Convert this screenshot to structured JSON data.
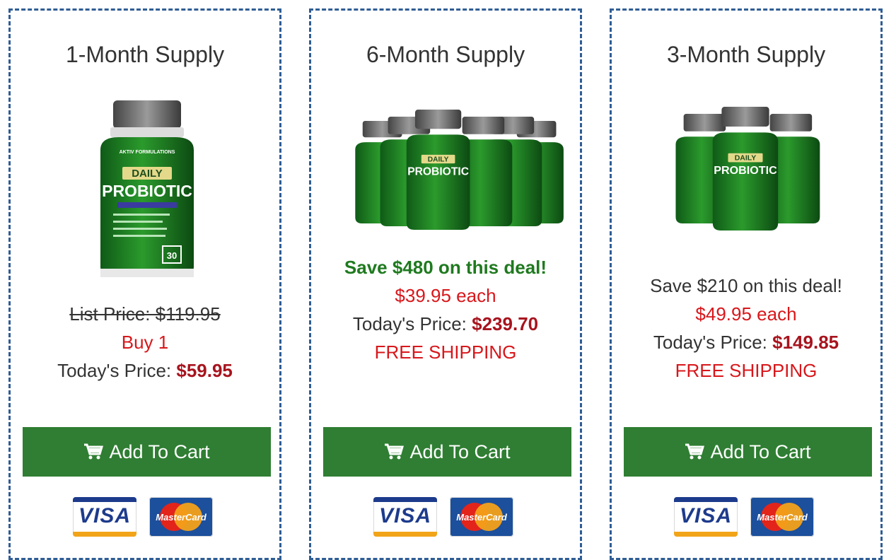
{
  "cards": [
    {
      "title": "1-Month Supply",
      "list_price": "List Price: $119.95",
      "buy_line": "Buy 1",
      "today_label": "Today's Price: ",
      "today_price": "$59.95",
      "button_label": "Add To Cart"
    },
    {
      "title": "6-Month Supply",
      "save_line": "Save $480 on this deal!",
      "each_line": "$39.95 each",
      "today_label": "Today's Price: ",
      "today_price": "$239.70",
      "shipping": "FREE SHIPPING",
      "button_label": "Add To Cart"
    },
    {
      "title": "3-Month Supply",
      "save_line": "Save $210 on this deal!",
      "each_line": "$49.95 each",
      "today_label": "Today's Price: ",
      "today_price": "$149.85",
      "shipping": "FREE SHIPPING",
      "button_label": "Add To Cart"
    }
  ],
  "product": {
    "brand": "AKTIV FORMULATIONS",
    "name_top": "DAILY",
    "name_bottom": "PROBIOTIC",
    "count": "30"
  },
  "payment": {
    "visa_label": "VISA",
    "mastercard_label": "MasterCard"
  },
  "colors": {
    "border": "#2f5d95",
    "button": "#2f7e33",
    "price_red": "#a7141e",
    "accent_red": "#d8171b",
    "save_green": "#1f7a1f",
    "bottle_green": "#2e8b2e"
  }
}
